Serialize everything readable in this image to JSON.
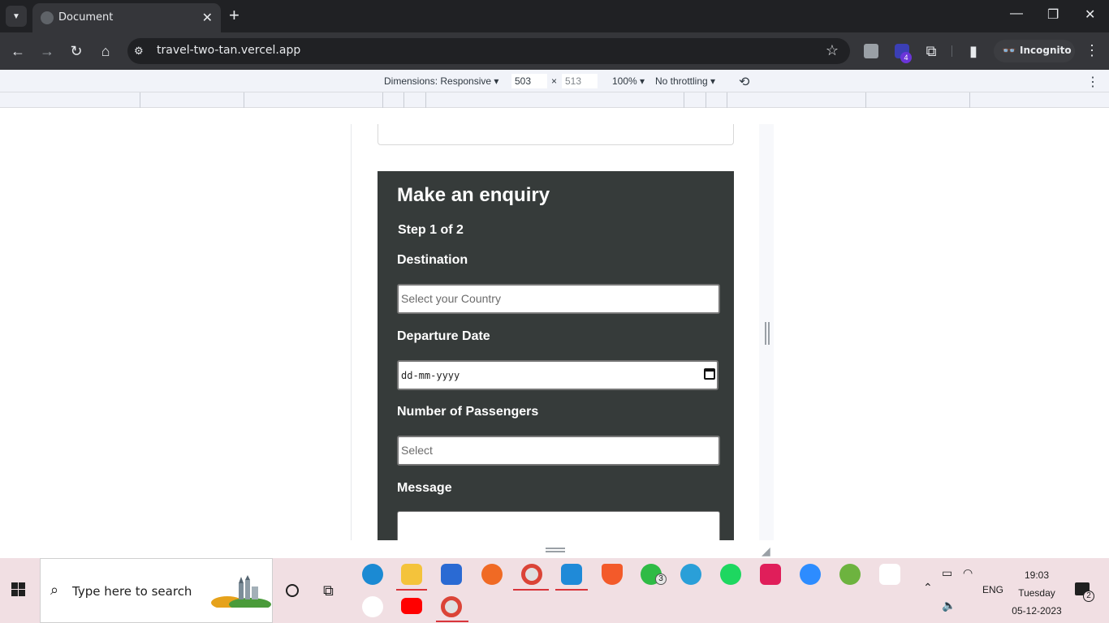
{
  "browser": {
    "tab_title": "Document",
    "url": "travel-two-tan.vercel.app",
    "profile_label": "Incognito",
    "extension_badge": "4"
  },
  "devtools": {
    "dimensions_label": "Dimensions: Responsive",
    "width": "503",
    "height_placeholder": "513",
    "times": "×",
    "zoom": "100%",
    "throttling": "No throttling"
  },
  "form": {
    "heading": "Make an enquiry",
    "step": "Step 1 of 2",
    "destination_label": "Destination",
    "destination_placeholder": "Select your Country",
    "departure_label": "Departure Date",
    "departure_value": "dd-mm-yyyy",
    "passengers_label": "Number of Passengers",
    "passengers_placeholder": "Select",
    "message_label": "Message"
  },
  "taskbar": {
    "search_placeholder": "Type here to search",
    "whatsapp_badge": "3",
    "language": "ENG",
    "time": "19:03",
    "day": "Tuesday",
    "date": "05-12-2023",
    "notifications": "2"
  },
  "colors": {
    "form_bg": "#363b3a",
    "chrome_dark": "#202124",
    "taskbar_bg": "#f1dfe3"
  }
}
